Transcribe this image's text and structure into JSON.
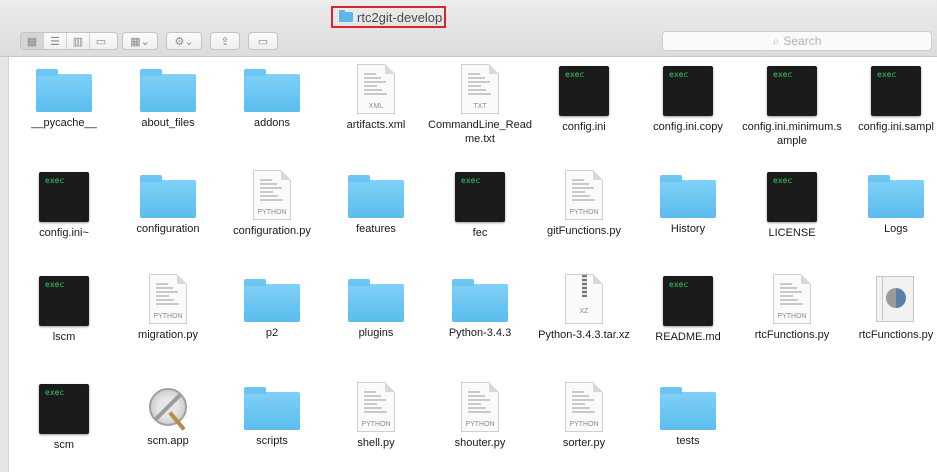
{
  "window": {
    "title": "rtc2git-develop"
  },
  "toolbar": {
    "view_icons": [
      "icon-view-icon",
      "list-view-icon",
      "column-view-icon",
      "cover-flow-icon"
    ],
    "arrange_caret": "⌄",
    "action_caret": "⌄"
  },
  "search": {
    "placeholder": "Search"
  },
  "files": [
    {
      "name": "__pycache__",
      "kind": "folder"
    },
    {
      "name": "about_files",
      "kind": "folder"
    },
    {
      "name": "addons",
      "kind": "folder"
    },
    {
      "name": "artifacts.xml",
      "kind": "doc",
      "tag": "XML"
    },
    {
      "name": "CommandLine_Readme.txt",
      "kind": "doc",
      "tag": "TXT"
    },
    {
      "name": "config.ini",
      "kind": "exec"
    },
    {
      "name": "config.ini.copy",
      "kind": "exec"
    },
    {
      "name": "config.ini.minimum.sample",
      "kind": "exec"
    },
    {
      "name": "config.ini.sampl",
      "kind": "exec"
    },
    {
      "name": "config.ini~",
      "kind": "exec"
    },
    {
      "name": "configuration",
      "kind": "folder"
    },
    {
      "name": "configuration.py",
      "kind": "doc",
      "tag": "PYTHON"
    },
    {
      "name": "features",
      "kind": "folder"
    },
    {
      "name": "fec",
      "kind": "exec"
    },
    {
      "name": "gitFunctions.py",
      "kind": "doc",
      "tag": "PYTHON"
    },
    {
      "name": "History",
      "kind": "folder"
    },
    {
      "name": "LICENSE",
      "kind": "exec"
    },
    {
      "name": "Logs",
      "kind": "folder"
    },
    {
      "name": "lscm",
      "kind": "exec"
    },
    {
      "name": "migration.py",
      "kind": "doc",
      "tag": "PYTHON"
    },
    {
      "name": "p2",
      "kind": "folder"
    },
    {
      "name": "plugins",
      "kind": "folder"
    },
    {
      "name": "Python-3.4.3",
      "kind": "folder"
    },
    {
      "name": "Python-3.4.3.tar.xz",
      "kind": "zip",
      "tag": "XZ"
    },
    {
      "name": "README.md",
      "kind": "exec"
    },
    {
      "name": "rtcFunctions.py",
      "kind": "doc",
      "tag": "PYTHON"
    },
    {
      "name": "rtcFunctions.py",
      "kind": "pyc"
    },
    {
      "name": "scm",
      "kind": "exec"
    },
    {
      "name": "scm.app",
      "kind": "app"
    },
    {
      "name": "scripts",
      "kind": "folder"
    },
    {
      "name": "shell.py",
      "kind": "doc",
      "tag": "PYTHON"
    },
    {
      "name": "shouter.py",
      "kind": "doc",
      "tag": "PYTHON"
    },
    {
      "name": "sorter.py",
      "kind": "doc",
      "tag": "PYTHON"
    },
    {
      "name": "tests",
      "kind": "folder"
    }
  ],
  "exec_label": "exec",
  "colors": {
    "title_highlight": "#d9262b",
    "folder": "#5bbdee",
    "exec_text": "#2ed15a"
  }
}
